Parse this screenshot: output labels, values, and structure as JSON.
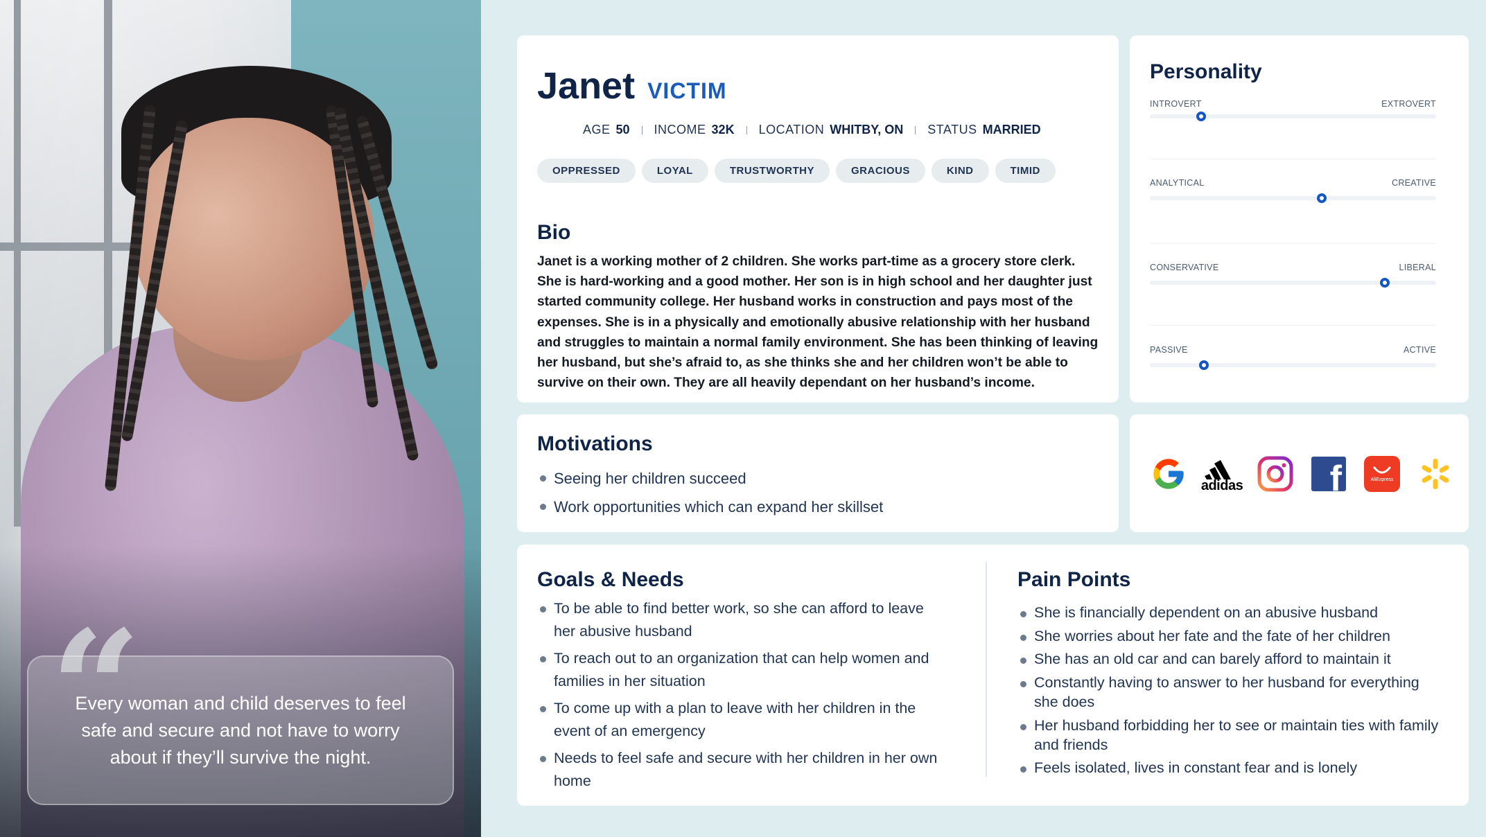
{
  "quote": {
    "mark": "“",
    "text": "Every woman and child deserves to feel safe and secure and not have to worry about if they’ll survive the night."
  },
  "profile": {
    "name": "Janet",
    "role": "VICTIM",
    "stats": [
      {
        "label": "AGE",
        "value": "50"
      },
      {
        "label": "INCOME",
        "value": "32K"
      },
      {
        "label": "LOCATION",
        "value": "WHITBY, ON"
      },
      {
        "label": "STATUS",
        "value": "MARRIED"
      }
    ],
    "tags": [
      "OPPRESSED",
      "LOYAL",
      "TRUSTWORTHY",
      "GRACIOUS",
      "KIND",
      "TIMID"
    ],
    "bio_title": "Bio",
    "bio": "Janet is a working mother of 2 children. She works part-time as a grocery store clerk. She is hard-working and a good mother. Her son is in high school and her daughter just started community college. Her husband works in construction and pays most of the expenses. She is in a physically and emotionally abusive relationship with her husband and struggles to maintain a normal family environment. She has been thinking of leaving her husband, but she’s afraid to, as she thinks she and her children won’t be able to survive on their own.  They are all heavily dependant on her husband’s income."
  },
  "personality": {
    "title": "Personality",
    "traits": [
      {
        "left": "INTROVERT",
        "right": "EXTROVERT",
        "level": 0.18
      },
      {
        "left": "ANALYTICAL",
        "right": "CREATIVE",
        "level": 0.6
      },
      {
        "left": "CONSERVATIVE",
        "right": "LIBERAL",
        "level": 0.82
      },
      {
        "left": "PASSIVE",
        "right": "ACTIVE",
        "level": 0.19
      }
    ],
    "accent_color": "#1656c2"
  },
  "motivations": {
    "title": "Motivations",
    "items": [
      "Seeing her children succeed",
      "Work opportunities which can expand her skillset"
    ]
  },
  "brands": {
    "items": [
      "google-icon",
      "adidas-icon",
      "instagram-icon",
      "facebook-icon",
      "aliexpress-icon",
      "walmart-icon"
    ],
    "adidas_text": "adidas",
    "aliexpress_text": "AliExpress",
    "facebook_text": "f"
  },
  "goals": {
    "title": "Goals & Needs",
    "items": [
      "To be able to find better work, so she can afford to leave her abusive husband",
      "To reach out to an organization that can help women and families in her situation",
      "To come up with a plan to leave with her children in the event of an emergency",
      "Needs to feel safe and secure with her children in her own home"
    ]
  },
  "pain_points": {
    "title": "Pain Points",
    "items": [
      "She is financially dependent on an abusive husband",
      "She worries about her fate and the fate of her children",
      "She has an old car and can barely afford to maintain it",
      "Constantly having to answer to her husband for everything she does",
      "Her husband forbidding her to see or maintain ties with family and friends",
      "Feels isolated, lives in constant fear and is lonely"
    ]
  },
  "colors": {
    "background": "#deedef",
    "heading": "#0f2446",
    "role": "#1a5cb8",
    "tag_bg": "#e7ecef"
  }
}
